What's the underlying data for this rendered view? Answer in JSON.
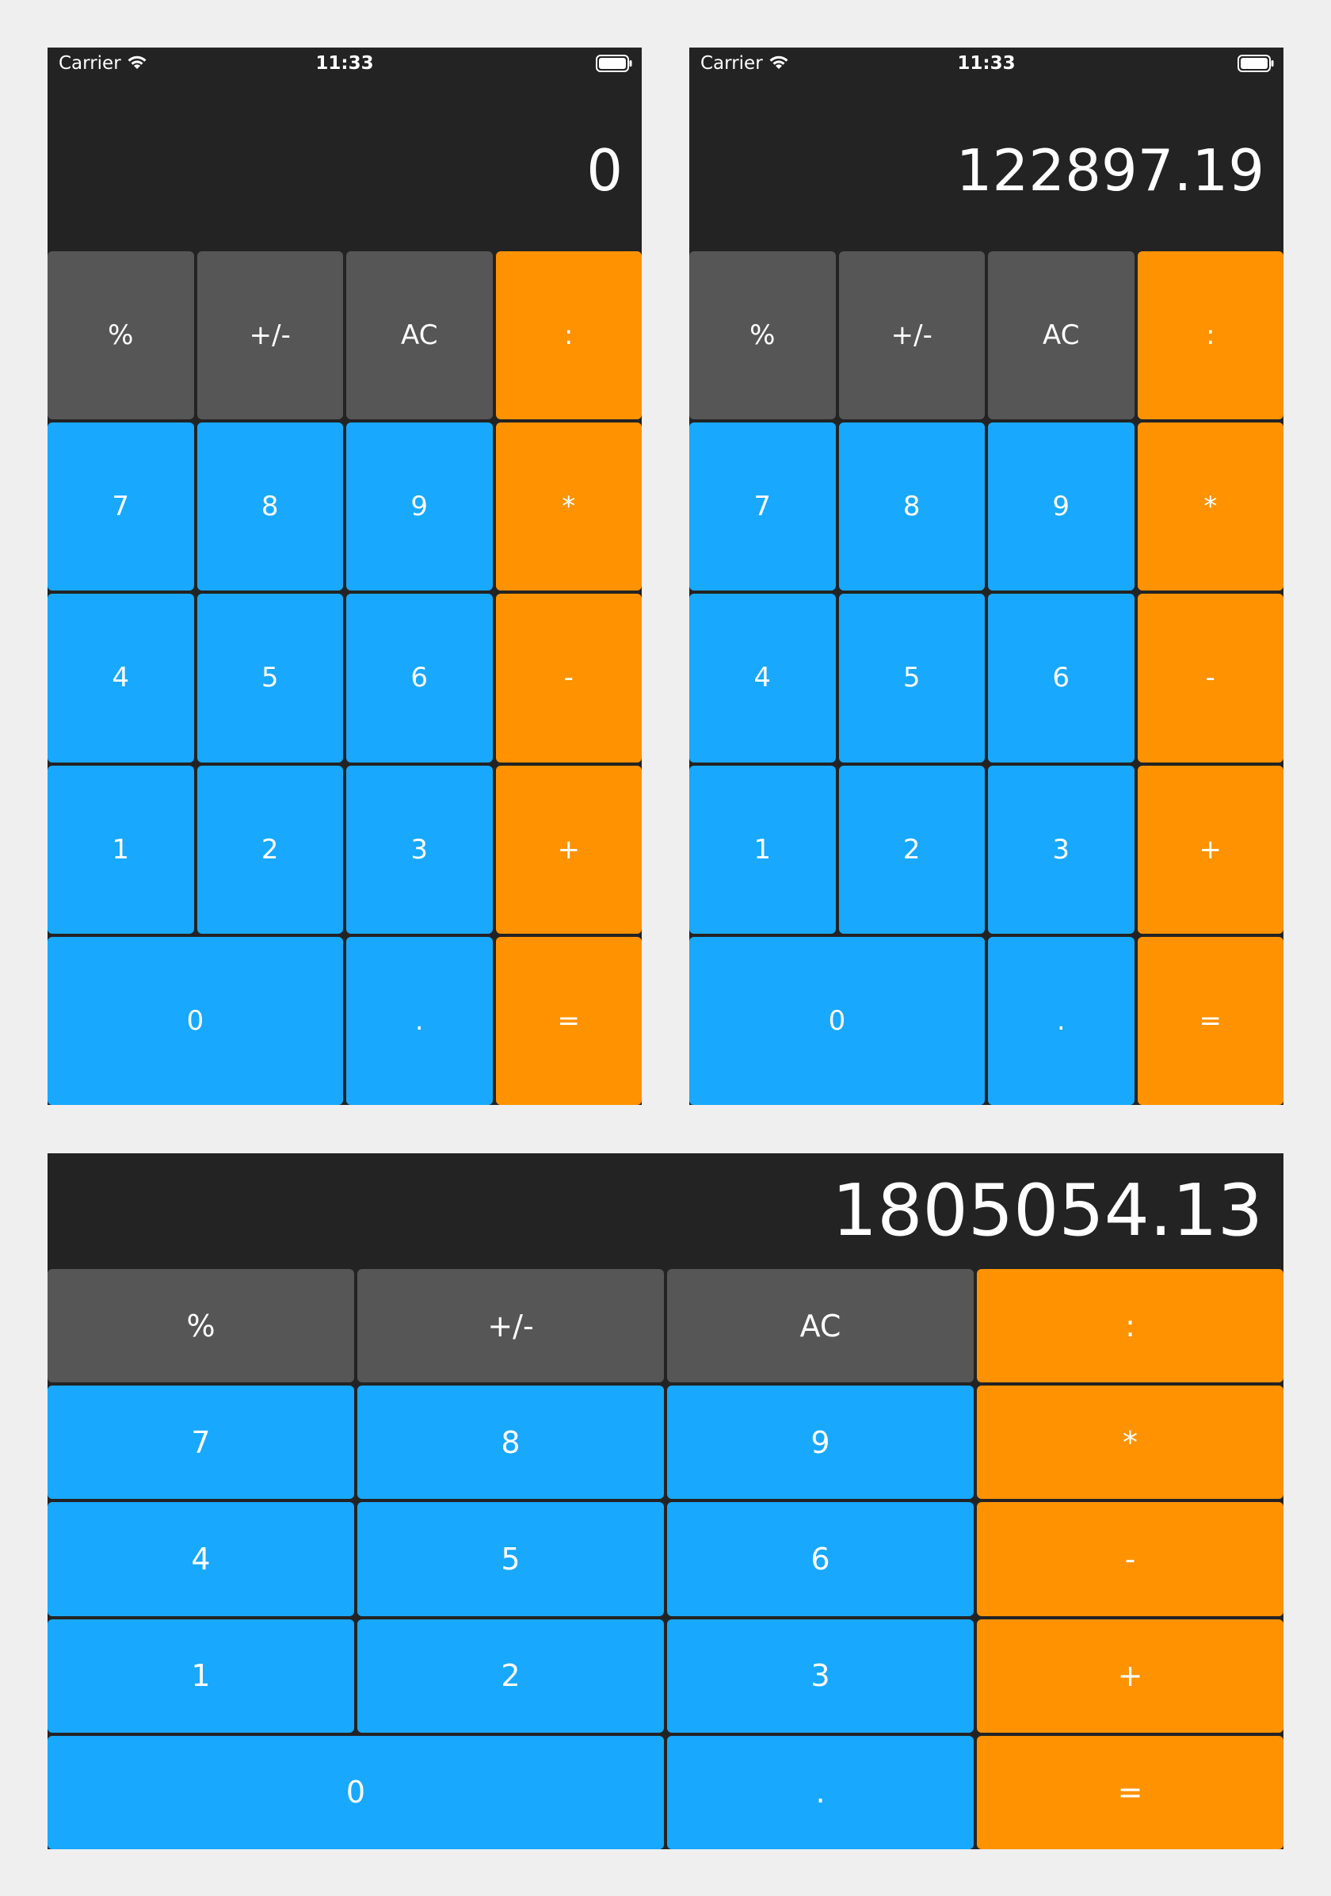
{
  "colors": {
    "page_bg": "#efefef",
    "calculator_bg": "#232323",
    "function_key": "#565656",
    "number_key": "#18a8fe",
    "operator_key": "#fe9200",
    "text": "#ffffff"
  },
  "status_bar": {
    "carrier": "Carrier",
    "time": "11:33",
    "icons": [
      "wifi-icon",
      "battery-icon"
    ]
  },
  "screens": {
    "portrait_a": {
      "display": "0"
    },
    "portrait_b": {
      "display": "122897.19"
    },
    "landscape": {
      "display": "1805054.13"
    }
  },
  "keys": {
    "percent": "%",
    "plus_minus": "+/-",
    "clear": "AC",
    "divide": ":",
    "seven": "7",
    "eight": "8",
    "nine": "9",
    "multiply": "*",
    "four": "4",
    "five": "5",
    "six": "6",
    "minus": "-",
    "one": "1",
    "two": "2",
    "three": "3",
    "plus": "+",
    "zero": "0",
    "decimal": ".",
    "equals": "="
  }
}
